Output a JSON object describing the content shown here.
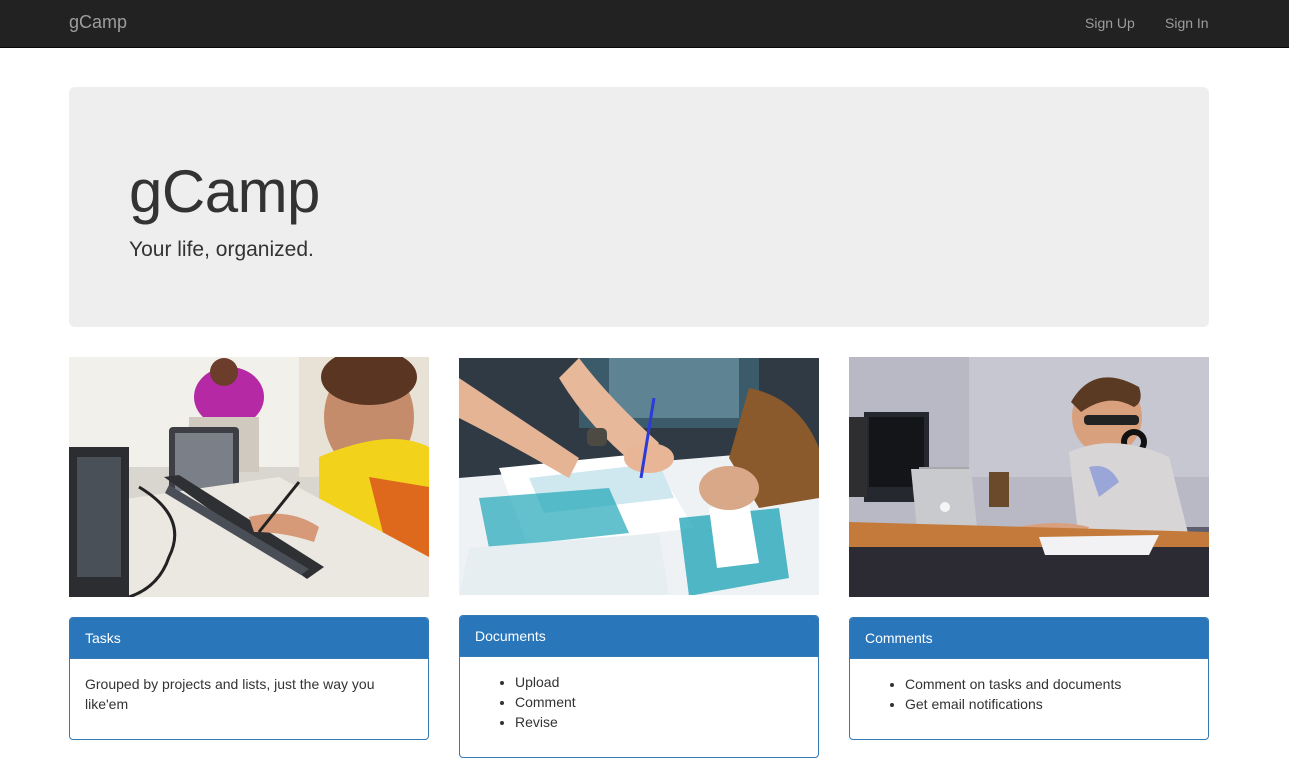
{
  "nav": {
    "brand": "gCamp",
    "links": [
      {
        "label": "Sign Up"
      },
      {
        "label": "Sign In"
      }
    ]
  },
  "hero": {
    "title": "gCamp",
    "subtitle": "Your life, organized."
  },
  "features": [
    {
      "heading": "Tasks",
      "text": "Grouped by projects and lists, just the way you like'em"
    },
    {
      "heading": "Documents",
      "items": [
        "Upload",
        "Comment",
        "Revise"
      ]
    },
    {
      "heading": "Comments",
      "items": [
        "Comment on tasks and documents",
        "Get email notifications"
      ]
    }
  ],
  "colors": {
    "navbar": "#222222",
    "nav_text": "#9d9d9d",
    "jumbotron": "#eeeeee",
    "panel_primary": "#2a76bb"
  }
}
